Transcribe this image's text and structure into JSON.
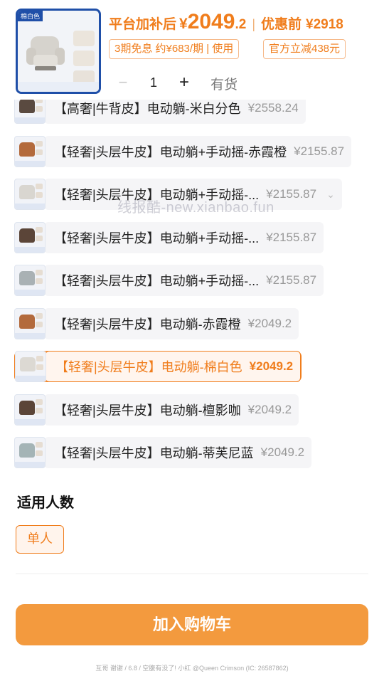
{
  "header": {
    "thumb_tag": "棉白色",
    "price_label": "平台加补后",
    "currency": "¥",
    "price_int": "2049",
    "price_dec": ".2",
    "separator": "|",
    "before_label": "优惠前",
    "before_price": "¥2918",
    "chips": [
      "3期免息 约¥683/期 | 使用",
      "官方立减438元"
    ],
    "minus": "−",
    "quantity": "1",
    "plus": "+",
    "stock": "有货"
  },
  "options": [
    {
      "name": "【高奢|牛背皮】电动躺-米白分色",
      "price": "¥2558.24",
      "chair_color": "#5a4a40",
      "selected": false
    },
    {
      "name": "【轻奢|头层牛皮】电动躺+手动摇-赤霞橙",
      "price": "¥2155.87",
      "chair_color": "#b36a3c",
      "selected": false
    },
    {
      "name": "【轻奢|头层牛皮】电动躺+手动摇-...",
      "price": "¥2155.87",
      "chair_color": "#d9d6d0",
      "selected": false,
      "chevron": "⌄"
    },
    {
      "name": "【轻奢|头层牛皮】电动躺+手动摇-...",
      "price": "¥2155.87",
      "chair_color": "#5b4538",
      "selected": false
    },
    {
      "name": "【轻奢|头层牛皮】电动躺+手动摇-...",
      "price": "¥2155.87",
      "chair_color": "#a9b1b4",
      "selected": false
    },
    {
      "name": "【轻奢|头层牛皮】电动躺-赤霞橙",
      "price": "¥2049.2",
      "chair_color": "#b36a3c",
      "selected": false
    },
    {
      "name": "【轻奢|头层牛皮】电动躺-棉白色",
      "price": "¥2049.2",
      "chair_color": "#dcd9d3",
      "selected": true
    },
    {
      "name": "【轻奢|头层牛皮】电动躺-檀影咖",
      "price": "¥2049.2",
      "chair_color": "#5b4538",
      "selected": false
    },
    {
      "name": "【轻奢|头层牛皮】电动躺-蒂芙尼蓝",
      "price": "¥2049.2",
      "chair_color": "#a4b4b6",
      "selected": false
    }
  ],
  "watermark": "线报酷-new.xianbao.fun",
  "people_section": {
    "title": "适用人数",
    "option": "单人"
  },
  "cart_button": "加入购物车",
  "footer_note": "互哥 谢谢 / 6.8 / 空腹有没了! 小红 @Queen Crimson (IC: 26587862)",
  "colors": {
    "accent": "#f07d1c",
    "button": "#f39a3e",
    "brand_blue": "#1f4fa8"
  }
}
